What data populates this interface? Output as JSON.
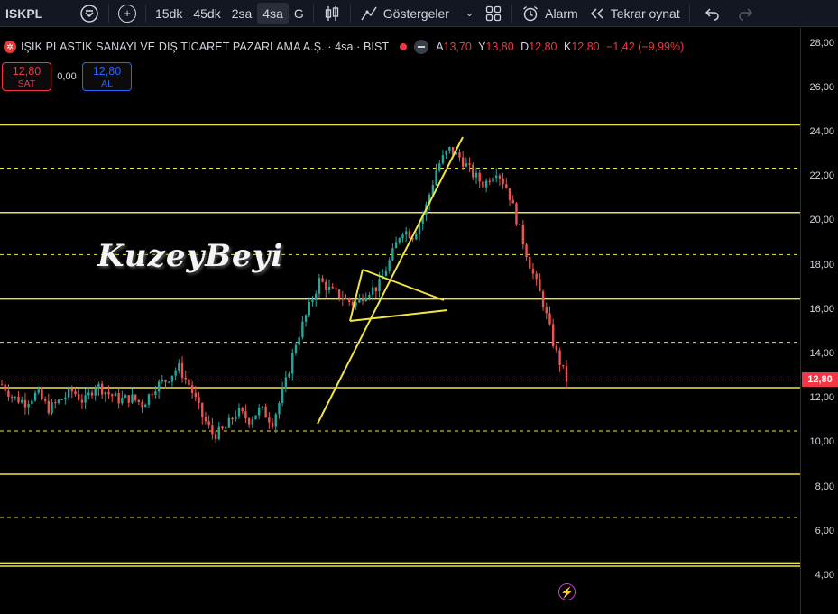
{
  "toolbar": {
    "symbol": "ISKPL",
    "intervals": [
      "15dk",
      "45dk",
      "2sa",
      "4sa",
      "G"
    ],
    "active_interval": "4sa",
    "indicators_label": "Göstergeler",
    "alarm_label": "Alarm",
    "replay_label": "Tekrar oynat"
  },
  "legend": {
    "title": "IŞIK PLASTİK SANAYİ VE DIŞ TİCARET PAZARLAMA A.Ş. · 4sa · BIST",
    "open_key": "A",
    "open": "13,70",
    "high_key": "Y",
    "high": "13,80",
    "low_key": "D",
    "low": "12,80",
    "close_key": "K",
    "close": "12,80",
    "change": "−1,42 (−9,99%)"
  },
  "trade": {
    "sell_price": "12,80",
    "sell_label": "SAT",
    "spread": "0,00",
    "buy_price": "12,80",
    "buy_label": "AL"
  },
  "watermark": "KuzeyBeyi",
  "price_axis": {
    "ticks": [
      "28,00",
      "26,00",
      "24,00",
      "22,00",
      "20,00",
      "18,00",
      "16,00",
      "14,00",
      "12,00",
      "10,00",
      "8,00",
      "6,00",
      "4,00"
    ],
    "last_price": "12,80"
  },
  "colors": {
    "up": "#26a69a",
    "down": "#ef5350",
    "lines": "#f0e442",
    "background": "#000000",
    "badge": "#f23645"
  },
  "chart_data": {
    "type": "candlestick",
    "ylim": [
      4,
      28
    ],
    "last_price": 12.8,
    "horizontal_levels_solid": [
      24.3,
      20.35,
      16.45,
      12.45,
      8.55,
      4.55,
      4.4
    ],
    "horizontal_levels_dashed": [
      22.35,
      18.45,
      14.5,
      10.5,
      6.6
    ],
    "approx_close_path": [
      12.6,
      12.0,
      11.8,
      12.2,
      11.5,
      11.9,
      12.3,
      11.8,
      12.6,
      12.2,
      11.9,
      12.0,
      11.7,
      12.5,
      12.8,
      13.4,
      12.5,
      11.2,
      10.3,
      10.6,
      11.4,
      11.0,
      11.5,
      10.9,
      12.4,
      14.5,
      15.9,
      17.3,
      16.8,
      16.5,
      16.2,
      16.8,
      17.0,
      18.2,
      19.6,
      19.3,
      20.5,
      22.4,
      23.2,
      22.8,
      22.1,
      21.6,
      22.3,
      21.4,
      19.6,
      17.8,
      16.3,
      14.2,
      12.8
    ]
  }
}
